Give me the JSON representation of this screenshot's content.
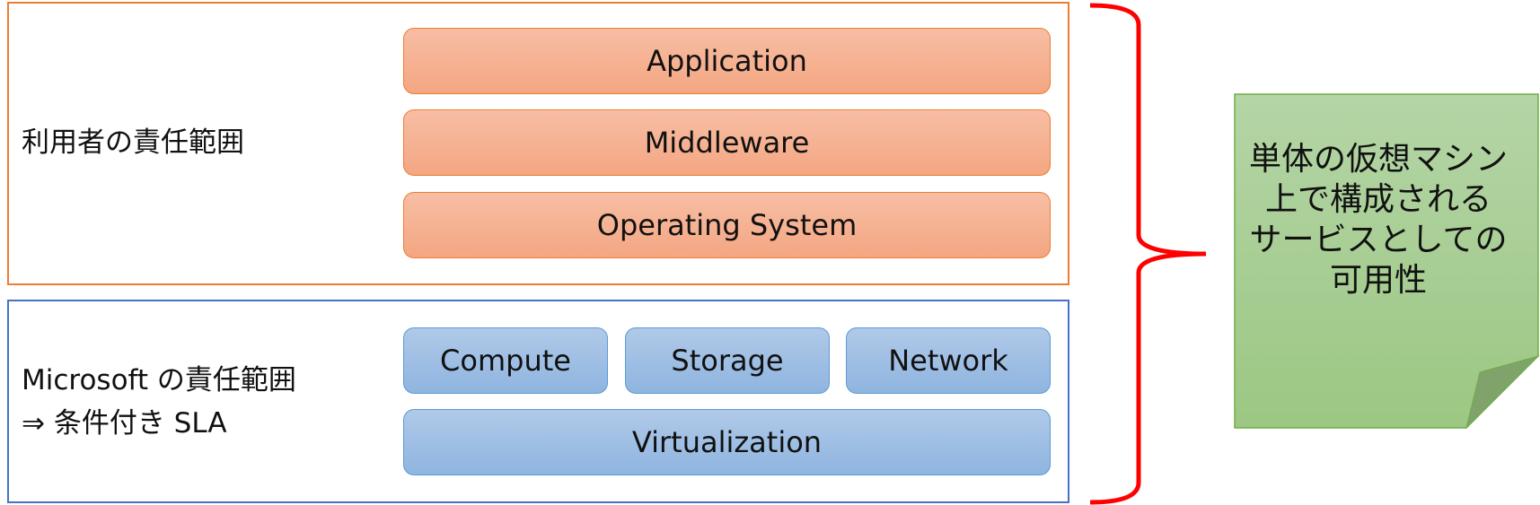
{
  "user_layer": {
    "label": "利用者の責任範囲",
    "items": [
      "Application",
      "Middleware",
      "Operating System"
    ],
    "color": "#ed7d31"
  },
  "provider_layer": {
    "label_line1": "Microsoft の責任範囲",
    "label_line2": "⇒ 条件付き SLA",
    "top_items": [
      "Compute",
      "Storage",
      "Network"
    ],
    "bottom_item": "Virtualization",
    "color": "#4472c4"
  },
  "brace": {
    "color": "#ff0000"
  },
  "note": {
    "lines": [
      "単体の仮想マシン",
      "上で構成される",
      "サービスとしての",
      "可用性"
    ],
    "color": "#a9d18e"
  }
}
